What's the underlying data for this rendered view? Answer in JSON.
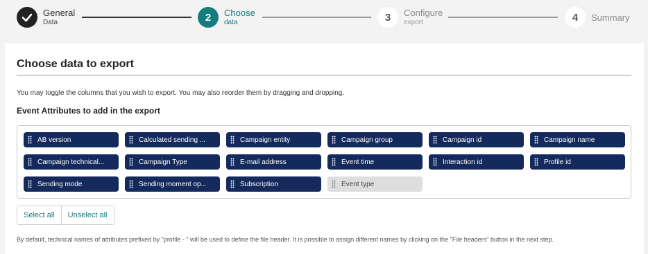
{
  "stepper": {
    "steps": [
      {
        "number": "",
        "icon": "check-icon",
        "title": "General",
        "subtitle": "Data",
        "state": "done"
      },
      {
        "number": "2",
        "title": "Choose",
        "subtitle": "data",
        "state": "active"
      },
      {
        "number": "3",
        "title": "Configure",
        "subtitle": "export",
        "state": "todo"
      },
      {
        "number": "4",
        "title": "Summary",
        "subtitle": "",
        "state": "todo"
      }
    ]
  },
  "card": {
    "title": "Choose data to export",
    "intro": "You may toggle the columns that you wish to export. You may also reorder them by dragging and dropping.",
    "section_title": "Event Attributes to add in the export",
    "attributes": [
      {
        "label": "AB version",
        "selected": true
      },
      {
        "label": "Calculated sending ...",
        "selected": true
      },
      {
        "label": "Campaign entity",
        "selected": true
      },
      {
        "label": "Campaign group",
        "selected": true
      },
      {
        "label": "Campaign id",
        "selected": true
      },
      {
        "label": "Campaign name",
        "selected": true
      },
      {
        "label": "Campaign technical...",
        "selected": true
      },
      {
        "label": "Campaign Type",
        "selected": true
      },
      {
        "label": "E-mail address",
        "selected": true
      },
      {
        "label": "Event time",
        "selected": true
      },
      {
        "label": "Interaction id",
        "selected": true
      },
      {
        "label": "Profile id",
        "selected": true
      },
      {
        "label": "Sending mode",
        "selected": true
      },
      {
        "label": "Sending moment op...",
        "selected": true
      },
      {
        "label": "Subscription",
        "selected": true
      },
      {
        "label": "Event type",
        "selected": false
      }
    ],
    "select_all_label": "Select all",
    "unselect_all_label": "Unselect all",
    "footnote": "By default, technical names of attributes prefixed by \"profile - \" will be used to define the file header. It is possible to assign different names by clicking on the \"File headers\" button in the next step."
  },
  "colors": {
    "accent": "#157d7e",
    "chip_selected": "#142a5c",
    "chip_unselected": "#dedede"
  }
}
